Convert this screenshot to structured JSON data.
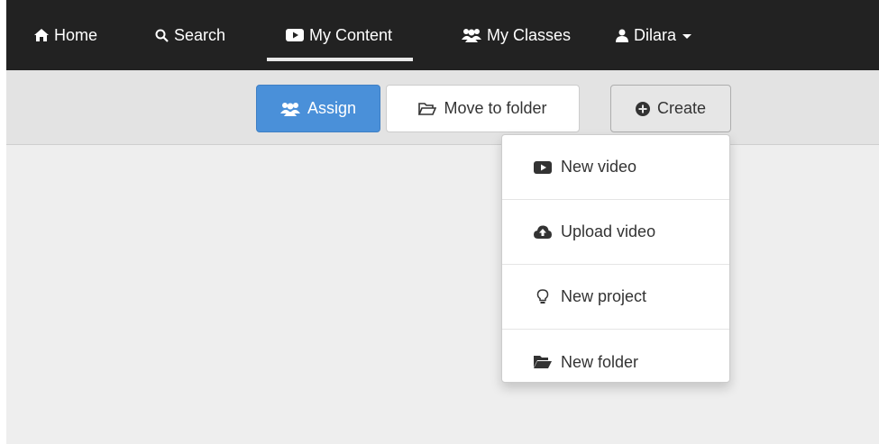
{
  "nav": {
    "items": [
      {
        "label": "Home",
        "icon": "home-icon"
      },
      {
        "label": "Search",
        "icon": "search-icon"
      },
      {
        "label": "My Content",
        "icon": "video-icon",
        "active": true
      },
      {
        "label": "My Classes",
        "icon": "users-icon"
      },
      {
        "label": "Dilara",
        "icon": "user-icon"
      }
    ]
  },
  "toolbar": {
    "assign_label": "Assign",
    "move_label": "Move to folder",
    "create_label": "Create"
  },
  "create_menu": {
    "items": [
      {
        "label": "New video",
        "icon": "video-icon"
      },
      {
        "label": "Upload video",
        "icon": "cloud-upload-icon"
      },
      {
        "label": "New project",
        "icon": "lightbulb-icon"
      },
      {
        "label": "New folder",
        "icon": "folder-open-icon"
      }
    ]
  },
  "colors": {
    "navbar_bg": "#222222",
    "toolbar_bg": "#e3e3e3",
    "main_bg": "#eeeeee",
    "primary": "#4a90d9"
  }
}
